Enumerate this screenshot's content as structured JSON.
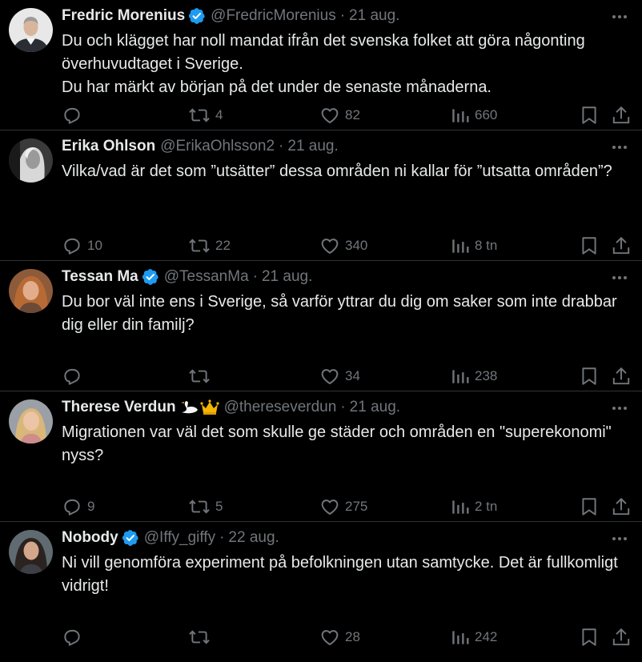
{
  "tweets": [
    {
      "name": "Fredric Morenius",
      "verified": true,
      "emoji": "",
      "handle": "@FredricMorenius",
      "separator": "·",
      "date": "21 aug.",
      "text": "Du och klägget har noll mandat ifrån det svenska folket att göra någonting överhuvudtaget i Sverige.\nDu har märkt av början på det under de senaste månaderna.",
      "replies": "",
      "retweets": "4",
      "likes": "82",
      "views": "660",
      "avatar": "man-suit"
    },
    {
      "name": "Erika Ohlson",
      "verified": false,
      "emoji": "",
      "handle": "@ErikaOhlsson2",
      "separator": "·",
      "date": "21 aug.",
      "text": "Vilka/vad är det som ”utsätter” dessa områden ni kallar för ”utsatta områden”?",
      "replies": "10",
      "retweets": "22",
      "likes": "340",
      "views": "8 tn",
      "avatar": "woman-blonde-bw"
    },
    {
      "name": "Tessan Ma",
      "verified": true,
      "emoji": "",
      "handle": "@TessanMa",
      "separator": "·",
      "date": "21 aug.",
      "text": "Du bor väl inte ens i Sverige, så varför yttrar du dig om saker som inte drabbar dig eller din familj?",
      "replies": "",
      "retweets": "",
      "likes": "34",
      "views": "238",
      "avatar": "woman-redhair"
    },
    {
      "name": "Therese Verdun",
      "verified": false,
      "emoji": "🦢👑",
      "handle": "@thereseverdun",
      "separator": "·",
      "date": "21 aug.",
      "text": "Migrationen var väl det som skulle ge städer och områden en \"superekonomi\" nyss?",
      "replies": "9",
      "retweets": "5",
      "likes": "275",
      "views": "2 tn",
      "avatar": "woman-blonde"
    },
    {
      "name": "Nobody",
      "verified": true,
      "emoji": "",
      "handle": "@Iffy_giffy",
      "separator": "·",
      "date": "22 aug.",
      "text": "Ni vill genomföra experiment på befolkningen utan samtycke. Det är fullkomligt vidrigt!",
      "replies": "",
      "retweets": "",
      "likes": "28",
      "views": "242",
      "avatar": "woman-darkhair"
    }
  ],
  "icons": {
    "more": "more-horizontal-icon",
    "reply": "reply-icon",
    "retweet": "retweet-icon",
    "like": "heart-icon",
    "views": "views-chart-icon",
    "bookmark": "bookmark-icon",
    "share": "share-icon",
    "verified": "verified-badge-icon"
  },
  "colors": {
    "background": "#000000",
    "text": "#e7e9ea",
    "secondary": "#71767b",
    "divider": "#2f3336",
    "verified": "#1d9bf0"
  }
}
